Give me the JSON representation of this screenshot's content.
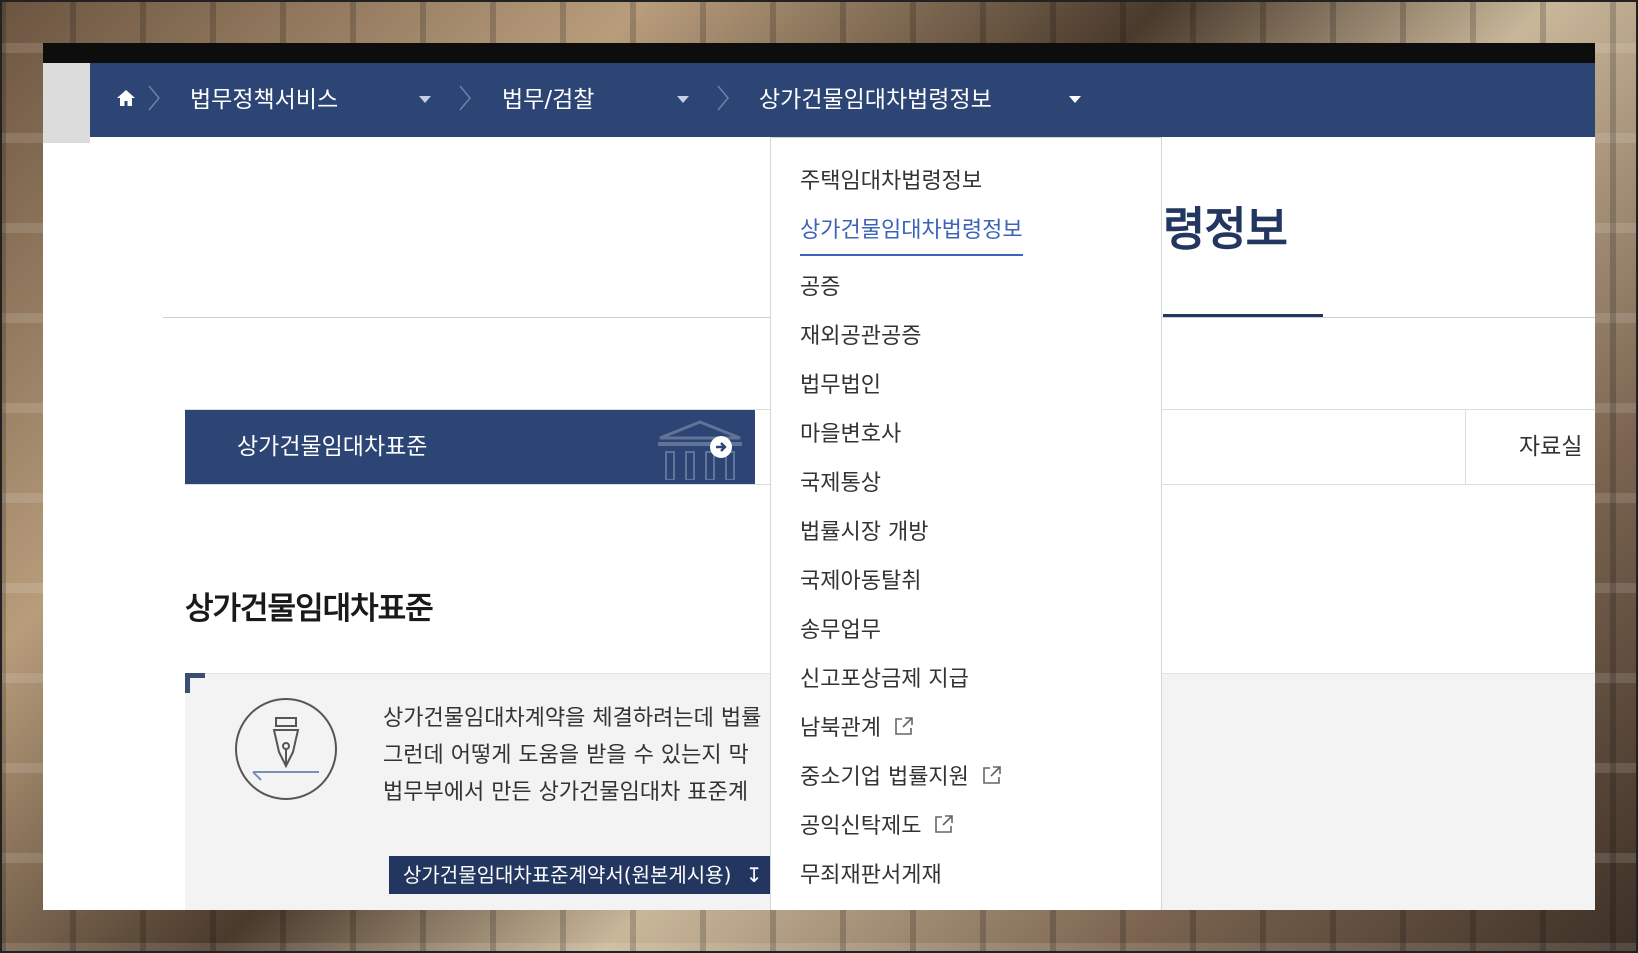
{
  "breadcrumb": {
    "home_icon": "home-icon",
    "level1": "법무정책서비스",
    "level2": "법무/검찰",
    "level3": "상가건물임대차법령정보"
  },
  "page": {
    "title_visible": "령정보"
  },
  "tabs": {
    "active": "상가건물임대차표준",
    "other": "자료실"
  },
  "section": {
    "heading": "상가건물임대차표준",
    "lines": [
      "상가건물임대차계약을 체결하려는데 법률",
      "그런데 어떻게 도움을 받을 수 있는지 막",
      "법무부에서 만든 상가건물임대차 표준계"
    ],
    "download_label": "상가건물임대차표준계약서(원본게시용)"
  },
  "dropdown": {
    "items": [
      {
        "label": "주택임대차법령정보",
        "external": false,
        "selected": false
      },
      {
        "label": "상가건물임대차법령정보",
        "external": false,
        "selected": true
      },
      {
        "label": "공증",
        "external": false,
        "selected": false
      },
      {
        "label": "재외공관공증",
        "external": false,
        "selected": false
      },
      {
        "label": "법무법인",
        "external": false,
        "selected": false
      },
      {
        "label": "마을변호사",
        "external": false,
        "selected": false
      },
      {
        "label": "국제통상",
        "external": false,
        "selected": false
      },
      {
        "label": "법률시장 개방",
        "external": false,
        "selected": false
      },
      {
        "label": "국제아동탈취",
        "external": false,
        "selected": false
      },
      {
        "label": "송무업무",
        "external": false,
        "selected": false
      },
      {
        "label": "신고포상금제 지급",
        "external": false,
        "selected": false
      },
      {
        "label": "남북관계",
        "external": true,
        "selected": false
      },
      {
        "label": "중소기업 법률지원",
        "external": true,
        "selected": false
      },
      {
        "label": "공익신탁제도",
        "external": true,
        "selected": false
      },
      {
        "label": "무죄재판서게재",
        "external": false,
        "selected": false
      }
    ]
  },
  "colors": {
    "navy": "#2c4574",
    "selected_blue": "#3d63b8"
  }
}
